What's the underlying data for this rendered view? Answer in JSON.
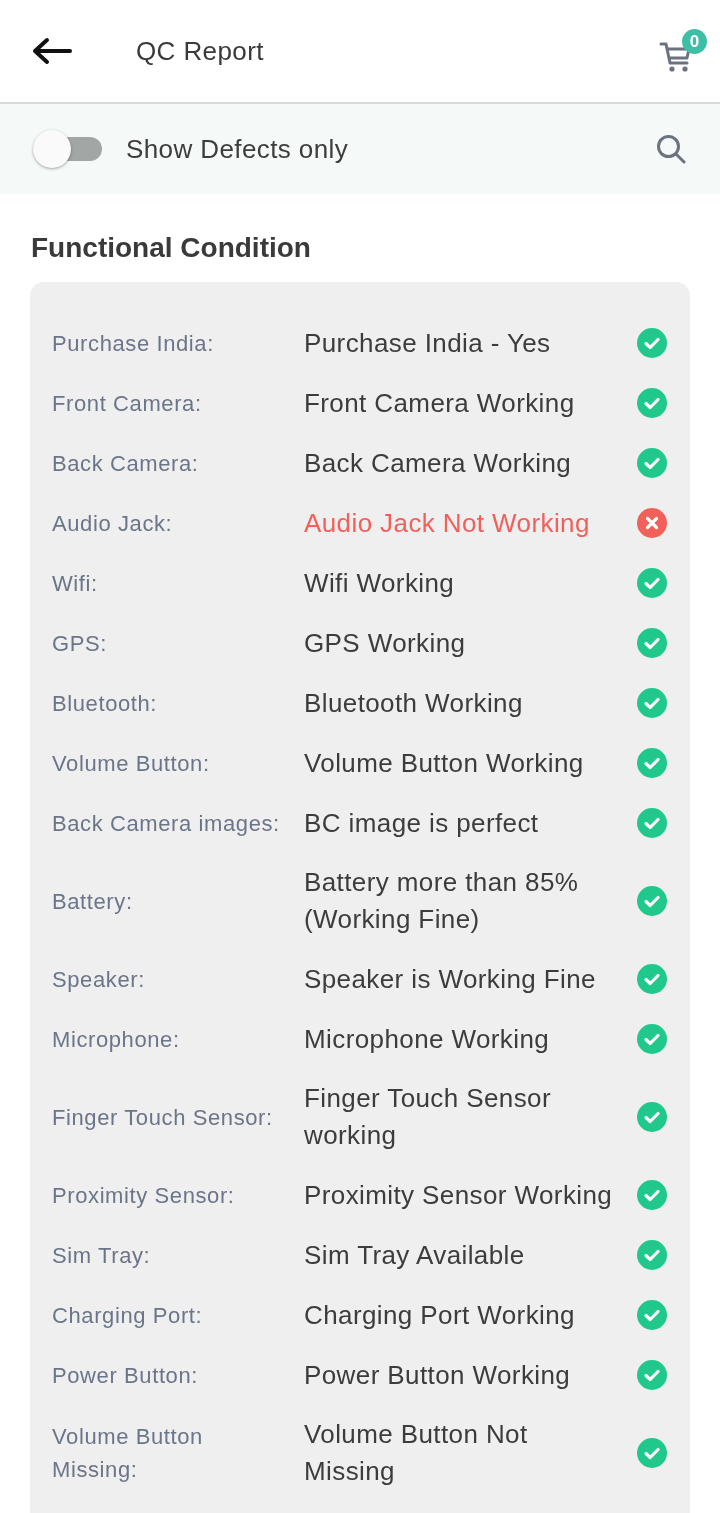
{
  "header": {
    "title": "QC Report",
    "cart_count": "0"
  },
  "filter": {
    "label": "Show Defects only",
    "on": false
  },
  "section": {
    "title": "Functional Condition",
    "items": [
      {
        "label": "Purchase India:",
        "value": "Purchase India - Yes",
        "defect": false
      },
      {
        "label": "Front Camera:",
        "value": "Front Camera Working",
        "defect": false
      },
      {
        "label": "Back Camera:",
        "value": "Back Camera Working",
        "defect": false
      },
      {
        "label": "Audio Jack:",
        "value": "Audio Jack Not Working",
        "defect": true
      },
      {
        "label": "Wifi:",
        "value": "Wifi Working",
        "defect": false
      },
      {
        "label": "GPS:",
        "value": "GPS Working",
        "defect": false
      },
      {
        "label": "Bluetooth:",
        "value": "Bluetooth Working",
        "defect": false
      },
      {
        "label": "Volume Button:",
        "value": "Volume Button Working",
        "defect": false
      },
      {
        "label": "Back Camera images:",
        "value": "BC image is perfect",
        "defect": false
      },
      {
        "label": "Battery:",
        "value": "Battery more than 85% (Working Fine)",
        "defect": false
      },
      {
        "label": "Speaker:",
        "value": "Speaker is Working Fine",
        "defect": false
      },
      {
        "label": "Microphone:",
        "value": "Microphone Working",
        "defect": false
      },
      {
        "label": "Finger Touch Sensor:",
        "value": "Finger Touch Sensor working",
        "defect": false
      },
      {
        "label": "Proximity Sensor:",
        "value": "Proximity Sensor Working",
        "defect": false
      },
      {
        "label": "Sim Tray:",
        "value": "Sim Tray Available",
        "defect": false
      },
      {
        "label": "Charging Port:",
        "value": "Charging Port Working",
        "defect": false
      },
      {
        "label": "Power Button:",
        "value": "Power Button Working",
        "defect": false
      },
      {
        "label": "Volume Button Missing:",
        "value": "Volume Button Not Missing",
        "defect": false
      }
    ]
  }
}
